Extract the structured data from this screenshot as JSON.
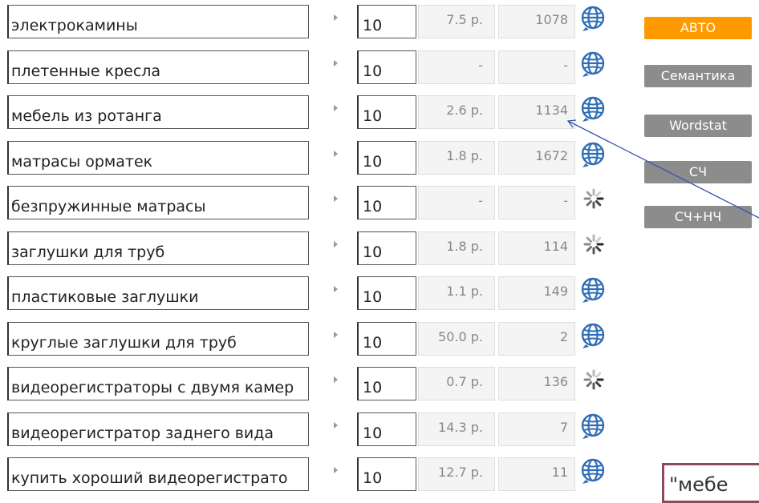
{
  "rows": [
    {
      "keyword": "электрокамины",
      "num": "10",
      "price": "7.5 р.",
      "count": "1078",
      "status": "globe"
    },
    {
      "keyword": "плетенные кресла",
      "num": "10",
      "price": "-",
      "count": "-",
      "status": "globe"
    },
    {
      "keyword": "мебель из ротанга",
      "num": "10",
      "price": "2.6 р.",
      "count": "1134",
      "status": "globe"
    },
    {
      "keyword": "матрасы орматек",
      "num": "10",
      "price": "1.8 р.",
      "count": "1672",
      "status": "globe"
    },
    {
      "keyword": "безпружинные матрасы",
      "num": "10",
      "price": "-",
      "count": "-",
      "status": "loading"
    },
    {
      "keyword": "заглушки для труб",
      "num": "10",
      "price": "1.8 р.",
      "count": "114",
      "status": "loading"
    },
    {
      "keyword": "пластиковые заглушки",
      "num": "10",
      "price": "1.1 р.",
      "count": "149",
      "status": "globe"
    },
    {
      "keyword": "круглые заглушки для труб",
      "num": "10",
      "price": "50.0 р.",
      "count": "2",
      "status": "globe"
    },
    {
      "keyword": "видеорегистраторы с двумя камер",
      "num": "10",
      "price": "0.7 р.",
      "count": "136",
      "status": "loading"
    },
    {
      "keyword": "видеорегистратор заднего вида",
      "num": "10",
      "price": "14.3 р.",
      "count": "7",
      "status": "globe"
    },
    {
      "keyword": "купить хороший видеорегистрато",
      "num": "10",
      "price": "12.7 р.",
      "count": "11",
      "status": "globe"
    }
  ],
  "buttons": {
    "avto": "АВТО",
    "semantika": "Семантика",
    "wordstat": "Wordstat",
    "sch": "СЧ",
    "sch_nch": "СЧ+НЧ"
  },
  "colors": {
    "avto": "#ff9900",
    "gray_button": "#8c8c8c",
    "callout_border": "#8c4a5a",
    "connector_line": "#3355aa"
  },
  "callout": {
    "text": "\"мебе"
  }
}
